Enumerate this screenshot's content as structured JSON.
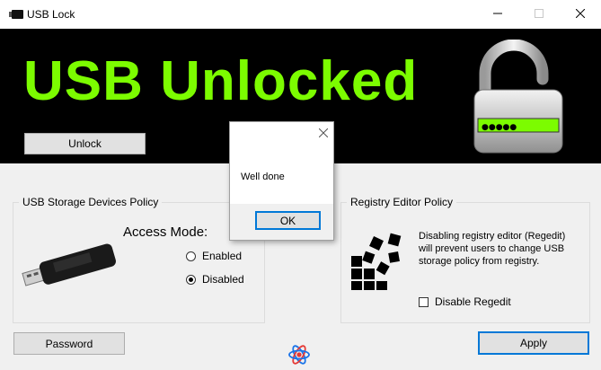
{
  "window": {
    "title": "USB Lock",
    "app_icon": "usb-drive-icon",
    "controls": [
      "minimize-icon",
      "maximize-icon",
      "close-icon"
    ]
  },
  "banner": {
    "headline": "USB Unlocked",
    "headline_color": "#7cfc00",
    "background": "#000000",
    "lock_icon": "open-padlock-icon",
    "password_mask": "●●●●●"
  },
  "buttons": {
    "unlock": "Unlock",
    "password": "Password",
    "apply": "Apply"
  },
  "usb_policy": {
    "legend": "USB Storage Devices Policy",
    "access_mode_label": "Access Mode:",
    "options": [
      {
        "label": "Enabled",
        "checked": false
      },
      {
        "label": "Disabled",
        "checked": true
      }
    ]
  },
  "registry_policy": {
    "legend": "Registry Editor Policy",
    "description": "Disabling registry editor (Regedit) will prevent users to change USB storage policy from registry.",
    "checkbox_label": "Disable Regedit",
    "checkbox_checked": false
  },
  "dialog": {
    "message": "Well done",
    "ok_label": "OK"
  },
  "colors": {
    "accent": "#0078d7",
    "lock_field": "#7cfc00"
  }
}
